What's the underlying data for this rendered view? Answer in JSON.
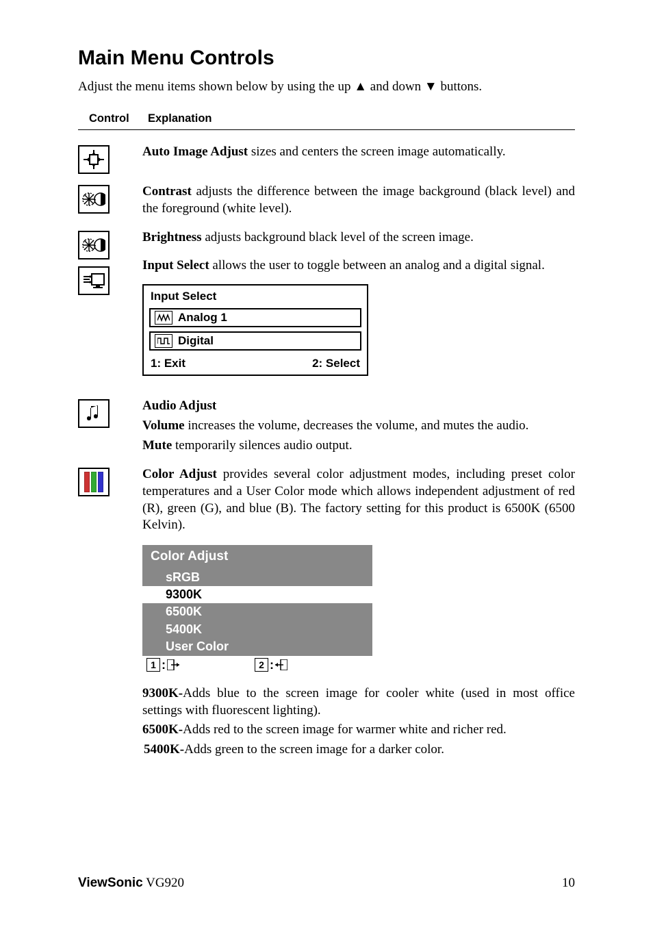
{
  "title": "Main Menu Controls",
  "intro_pre": "Adjust the menu items shown below by using the up ",
  "intro_post": " buttons.",
  "and_down": " and down ",
  "headers": {
    "control": "Control",
    "explanation": "Explanation"
  },
  "items": {
    "auto": {
      "label": "Auto Image Adjust",
      "text": " sizes and centers the screen image automatically."
    },
    "contrast": {
      "label": "Contrast",
      "text": " adjusts the difference between the image background  (black level) and the foreground (white level)."
    },
    "brightness": {
      "label": "Brightness",
      "text": " adjusts background black level of the screen image."
    },
    "input": {
      "label": "Input Select",
      "text": " allows the user to toggle between an analog and a digital signal."
    },
    "audio": {
      "label": "Audio Adjust",
      "volume_label": "Volume",
      "volume_text": " increases the volume, decreases the volume, and mutes the audio.",
      "mute_label": "Mute",
      "mute_text": " temporarily silences audio output."
    },
    "color": {
      "label": "Color Adjust",
      "text": " provides several color adjustment modes, including preset color temperatures and a User Color mode which allows independent adjustment of red (R), green (G), and blue (B). The factory setting for this product is 6500K (6500 Kelvin)."
    }
  },
  "osd_input": {
    "title": "Input Select",
    "opt1": "Analog 1",
    "opt2": "Digital",
    "exit": "1: Exit",
    "select": "2: Select"
  },
  "osd_color": {
    "title": "Color Adjust",
    "srgb": "sRGB",
    "k9300": "9300K",
    "k6500": "6500K",
    "k5400": "5400K",
    "user": "User Color"
  },
  "notes": {
    "k9300_label": "9300K-",
    "k9300_text": "Adds blue to the screen image for cooler white (used in most office settings with fluorescent lighting).",
    "k6500_label": "6500K-",
    "k6500_text": "Adds red to the screen image for warmer white and richer red.",
    "k5400_label": "5400K-",
    "k5400_text": "Adds green to the screen image for a darker color."
  },
  "footer": {
    "brand": "ViewSonic",
    "model": "  VG920",
    "page": "10"
  }
}
